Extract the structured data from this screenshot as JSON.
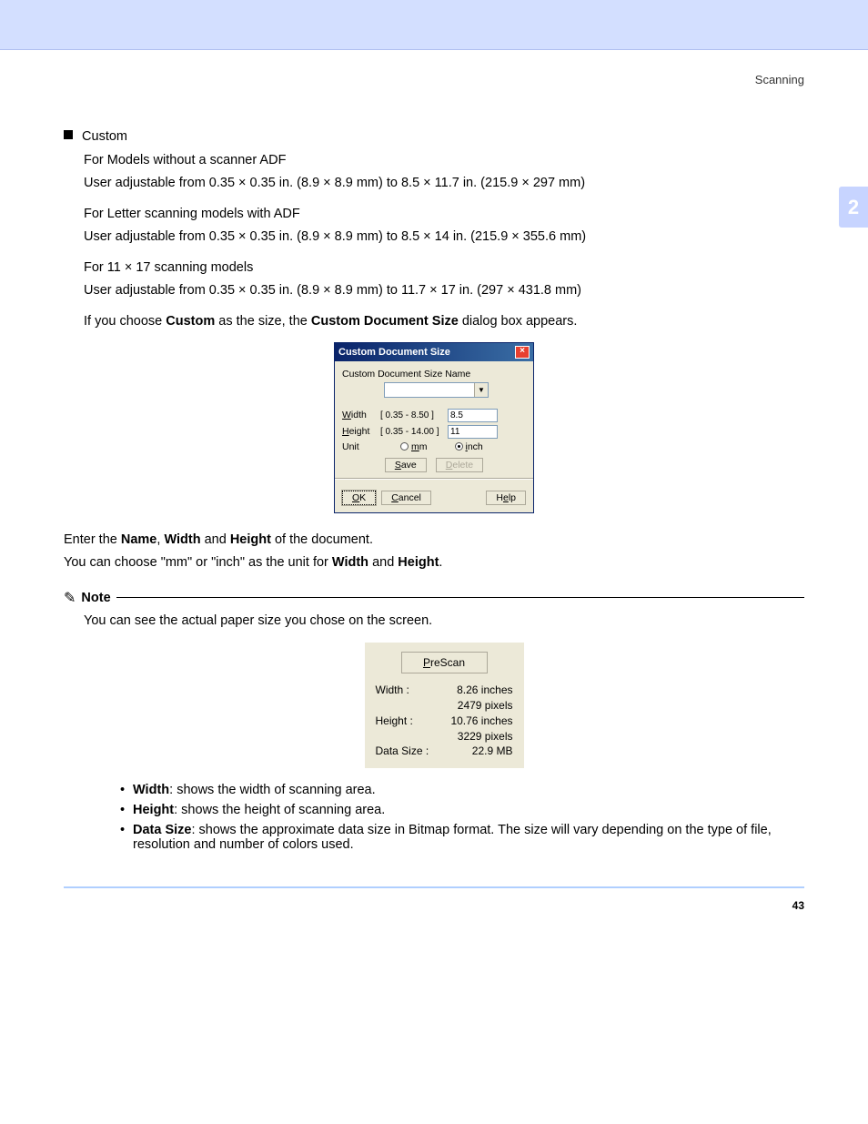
{
  "header": {
    "section": "Scanning",
    "chapter": "2"
  },
  "custom": {
    "title": "Custom",
    "noadf_title": "For Models without a scanner ADF",
    "noadf_text": "User adjustable from 0.35 × 0.35 in. (8.9 × 8.9 mm) to 8.5 × 11.7 in. (215.9 × 297 mm)",
    "letter_title": "For Letter scanning models with ADF",
    "letter_text": "User adjustable from 0.35 × 0.35 in. (8.9 × 8.9 mm) to 8.5 × 14 in. (215.9 × 355.6 mm)",
    "ledger_title": "For 11 × 17 scanning models",
    "ledger_text": "User adjustable from 0.35 × 0.35 in. (8.9 × 8.9 mm) to 11.7 × 17 in. (297 × 431.8 mm)",
    "choose_prefix": "If you choose ",
    "choose_bold1": "Custom",
    "choose_mid": " as the size, the ",
    "choose_bold2": "Custom Document Size",
    "choose_suffix": " dialog box appears."
  },
  "dialog": {
    "title": "Custom Document Size",
    "name_label": "Custom Document Size Name",
    "width_label": "Width",
    "width_range": "[  0.35  -   8.50  ]",
    "width_value": "8.5",
    "height_label": "Height",
    "height_range": "[  0.35  -  14.00  ]",
    "height_value": "11",
    "unit_label": "Unit",
    "unit_mm": "mm",
    "unit_inch": "inch",
    "save": "Save",
    "delete": "Delete",
    "ok": "OK",
    "cancel": "Cancel",
    "help": "Help"
  },
  "after_dialog": {
    "enter_prefix": "Enter the ",
    "b1": "Name",
    "sep1": ", ",
    "b2": "Width",
    "sep2": " and ",
    "b3": "Height",
    "suffix": " of the document.",
    "unit_prefix": "You can choose \"mm\" or \"inch\" as the unit for ",
    "unit_b1": "Width",
    "unit_sep": " and ",
    "unit_b2": "Height",
    "unit_suffix": "."
  },
  "note": {
    "label": "Note",
    "text": "You can see the actual paper size you chose on the screen."
  },
  "prescan": {
    "button": "PreScan",
    "width_label": "Width :",
    "width_val": "8.26 inches",
    "width_px": "2479 pixels",
    "height_label": "Height :",
    "height_val": "10.76 inches",
    "height_px": "3229 pixels",
    "ds_label": "Data Size :",
    "ds_val": "22.9 MB"
  },
  "defs": {
    "width_b": "Width",
    "width_t": ": shows the width of scanning area.",
    "height_b": "Height",
    "height_t": ": shows the height of scanning area.",
    "ds_b": "Data Size",
    "ds_t": ": shows the approximate data size in Bitmap format. The size will vary depending on the type of file, resolution and number of colors used."
  },
  "page_number": "43"
}
